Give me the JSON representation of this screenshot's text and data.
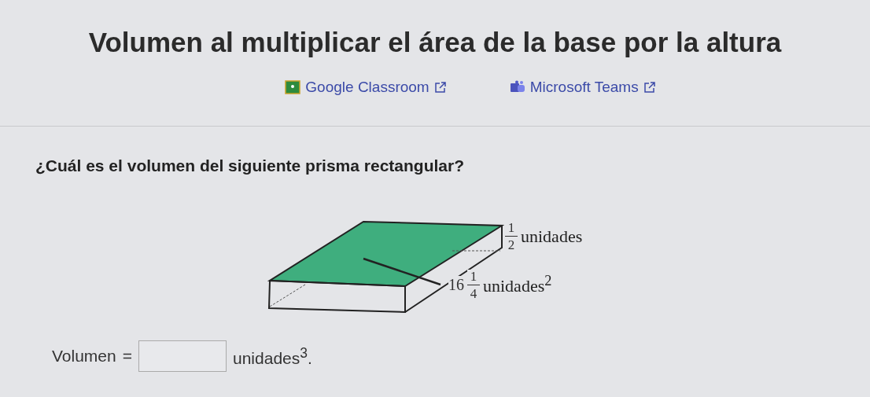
{
  "title": "Volumen al multiplicar el área de la base por la altura",
  "share_links": [
    {
      "label": "Google Classroom",
      "kind": "classroom"
    },
    {
      "label": "Microsoft Teams",
      "kind": "teams"
    }
  ],
  "question": "¿Cuál es el volumen del siguiente prisma rectangular?",
  "figure": {
    "height_label": {
      "numerator": "1",
      "denominator": "2",
      "unit": "unidades"
    },
    "area_label": {
      "whole": "16",
      "numerator": "1",
      "denominator": "4",
      "unit": "unidades$^{2}$"
    }
  },
  "answer": {
    "label": "Volumen",
    "equals": "=",
    "unit": "unidades$^{3}$."
  }
}
